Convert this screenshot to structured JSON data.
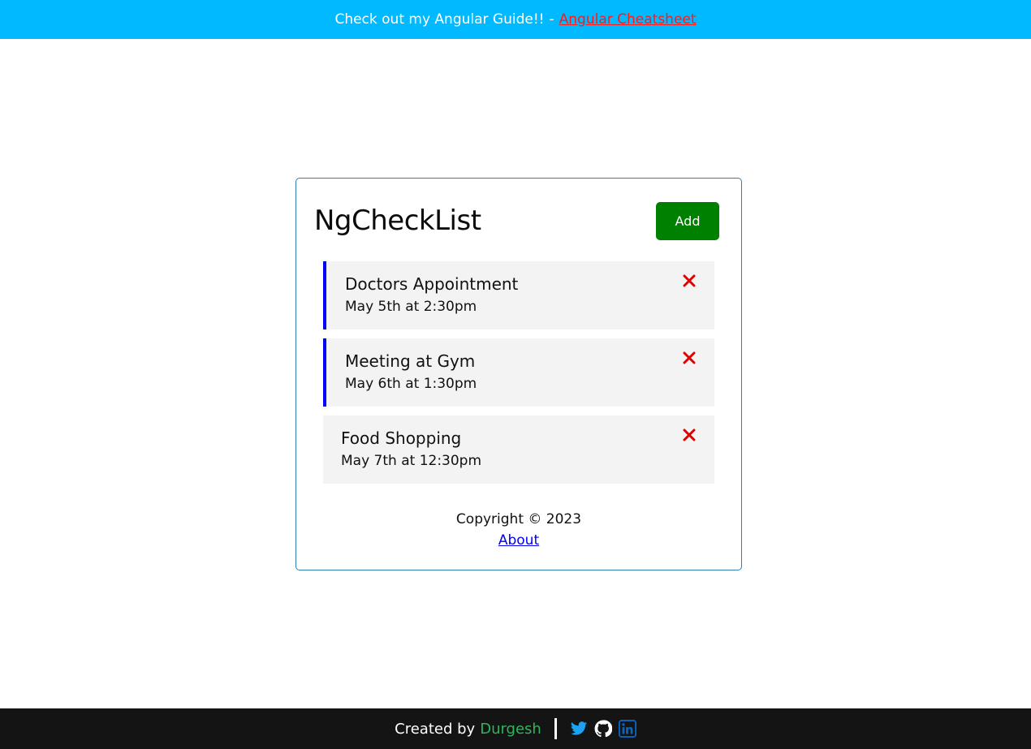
{
  "banner": {
    "text": "Check out my Angular Guide!!",
    "separator": "-",
    "link_label": "Angular Cheatsheet"
  },
  "header": {
    "title": "NgCheckList",
    "add_label": "Add"
  },
  "tasks": [
    {
      "title": "Doctors Appointment",
      "day": "May 5th at 2:30pm",
      "reminder": true
    },
    {
      "title": "Meeting at Gym",
      "day": "May 6th at 1:30pm",
      "reminder": true
    },
    {
      "title": "Food Shopping",
      "day": "May 7th at 12:30pm",
      "reminder": false
    }
  ],
  "footer": {
    "copyright": "Copyright © 2023",
    "about_label": "About"
  },
  "bottom_bar": {
    "created_by": "Created by",
    "author": "Durgesh"
  },
  "icons": {
    "delete": "close-icon",
    "twitter": "twitter-icon",
    "github": "github-icon",
    "linkedin": "linkedin-icon"
  },
  "colors": {
    "banner_bg": "#00b9ff",
    "banner_link": "#ff1a1a",
    "add_button": "#008000",
    "reminder_border": "#0000ff",
    "delete_icon": "#e00000",
    "bottom_bar_bg": "#141414",
    "author": "#2fb55a",
    "twitter": "#1da1f2",
    "linkedin": "#0a66c2"
  }
}
